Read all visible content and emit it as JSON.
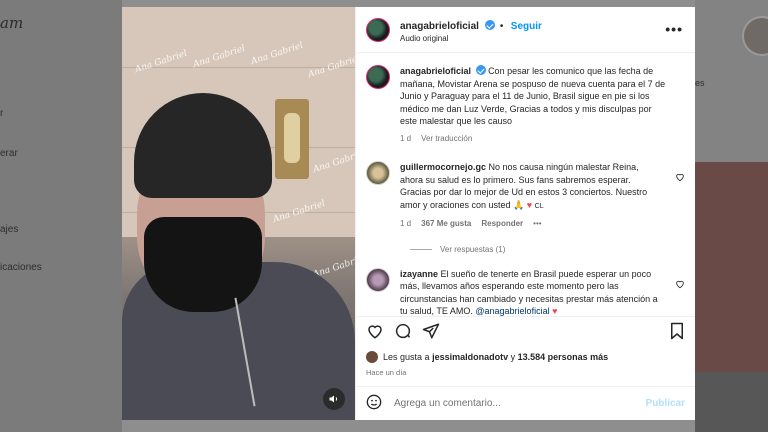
{
  "background": {
    "logo": "am",
    "nav_items": [
      "r",
      "erar",
      "ajes",
      "icaciones"
    ],
    "story_label": "es"
  },
  "post": {
    "username": "anagabrieloficial",
    "follow_label": "Seguir",
    "subtitle": "Audio original",
    "watermark": "Ana Gabriel",
    "caption": "Con pesar les comunico que las fecha de mañana, Movistar Arena se pospuso de nueva cuenta para el 7 de Junio y Paraguay para el 11 de Junio, Brasil sigue en pie si los médico me dan Luz Verde, Gracias a todos y mis disculpas por este malestar que les causo",
    "caption_time": "1 d",
    "translate_label": "Ver traducción"
  },
  "comments": [
    {
      "username": "guillermocornejo.gc",
      "text": "No nos causa ningún malestar Reina, ahora su salud es lo primero. Sus fans sabremos esperar. Gracias por dar lo mejor de Ud en estos 3 conciertos. Nuestro amor y oraciones con usted 🙏",
      "suffix": "CL",
      "time": "1 d",
      "likes": "367 Me gusta",
      "reply_label": "Responder",
      "more": "•••",
      "view_replies": "Ver respuestas (1)"
    },
    {
      "username": "izayanne",
      "text": "El sueño de tenerte en Brasil puede esperar un poco más, llevamos años esperando este momento pero las circunstancias han cambiado y necesitas prestar más atención a tu salud, TE AMO.",
      "mention": "@anagabrieloficial"
    }
  ],
  "likes": {
    "prefix": "Les gusta a",
    "user": "jessimaldonadotv",
    "conj": "y",
    "count": "13.584 personas más"
  },
  "time_ago": "Hace un día",
  "add_comment": {
    "placeholder": "Agrega un comentario...",
    "post_label": "Publicar"
  },
  "colors": {
    "accent": "#0095f6",
    "verified": "#3897f0",
    "heart_red": "#ed4956"
  },
  "icons": [
    "heart-icon",
    "comment-icon",
    "share-icon",
    "bookmark-icon",
    "emoji-icon",
    "more-icon",
    "mute-icon"
  ]
}
